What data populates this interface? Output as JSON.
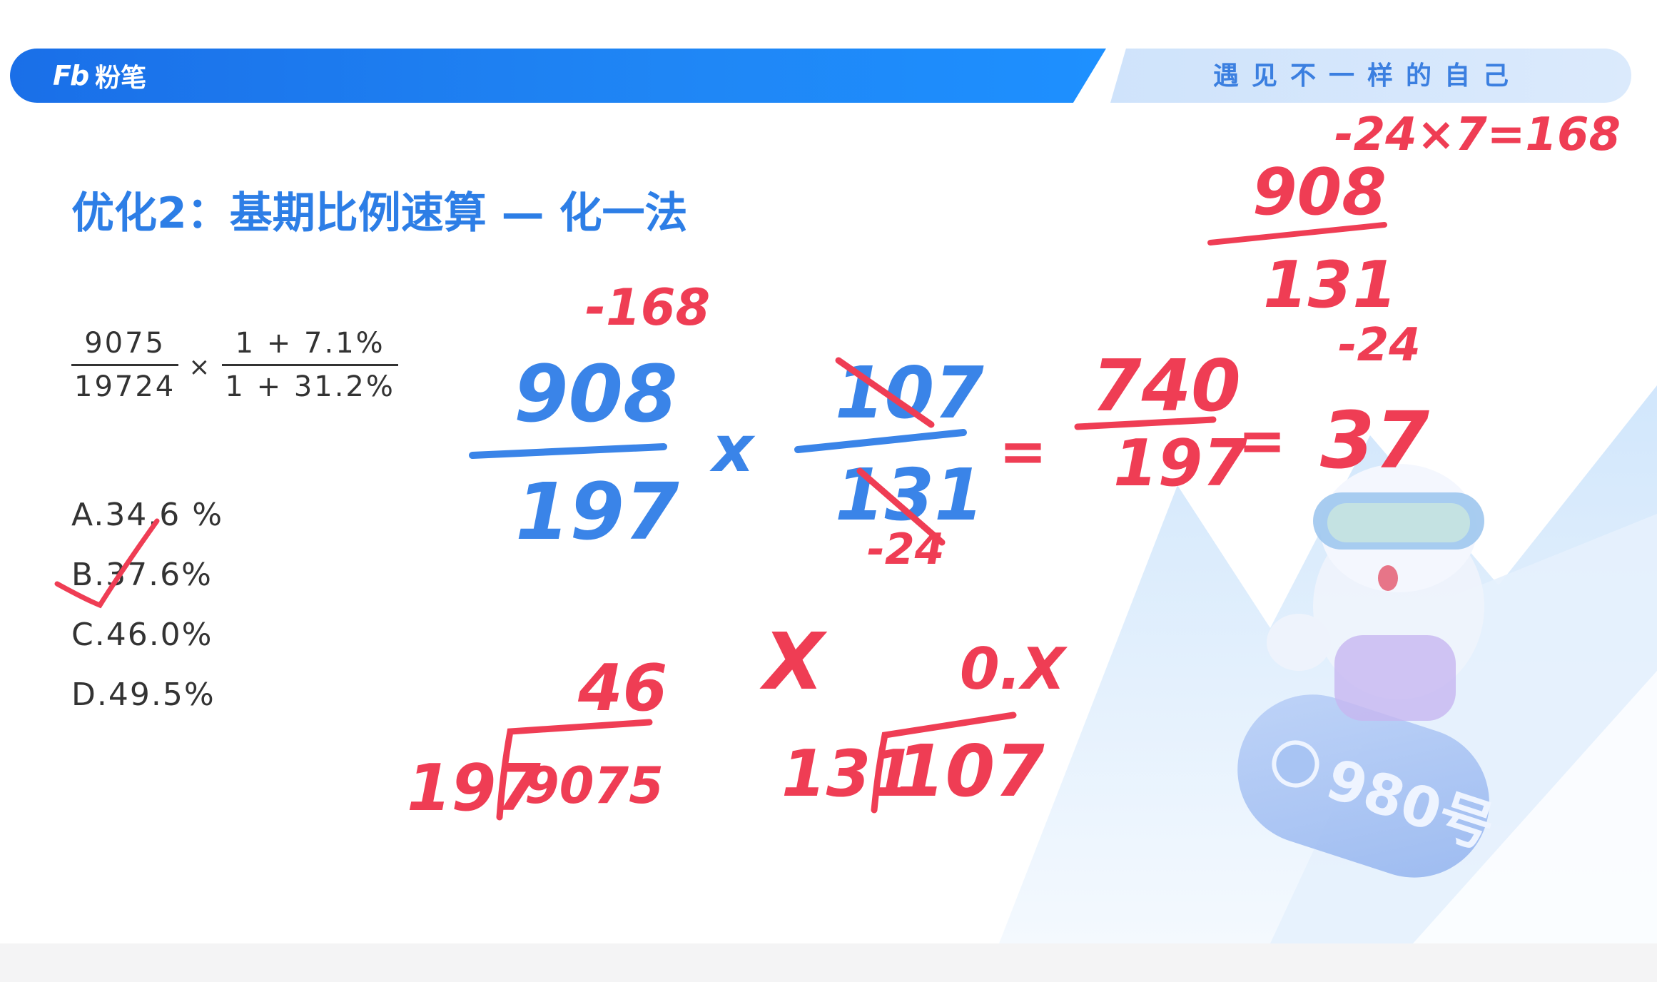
{
  "header": {
    "logo_mark": "Fb",
    "logo_text": "粉笔",
    "slogan": "遇见不一样的自己"
  },
  "slide": {
    "title": "优化2：基期比例速算 — 化一法"
  },
  "formula": {
    "frac1_num": "9075",
    "frac1_den": "19724",
    "times": "×",
    "frac2_num": "1 + 7.1%",
    "frac2_den": "1 + 31.2%"
  },
  "options": [
    {
      "label": "A.34.6 %"
    },
    {
      "label": "B.37.6%"
    },
    {
      "label": "C.46.0%"
    },
    {
      "label": "D.49.5%"
    }
  ],
  "handwriting": {
    "blue_frac1_num": "908",
    "blue_frac1_den": "197",
    "blue_times": "x",
    "blue_frac2_num": "107",
    "blue_frac2_den": "131",
    "red_minus168": "-168",
    "red_eq1": "=",
    "red_result_num": "740",
    "red_result_den": "197",
    "red_eq2": "=",
    "red_37": "37",
    "red_minus24_top": "-24",
    "red_minus24_side": "-24",
    "red_top_expr": "-24×7=168",
    "red_top_num": "908",
    "red_top_den": "131",
    "red_div1_quot": "46",
    "red_div1_divisor": "197",
    "red_div1_dividend": "9075",
    "red_x": "X",
    "red_div2_quot": "0.X",
    "red_div2_divisor": "131",
    "red_div2_dividend": "107"
  },
  "mascot": {
    "badge": "980号"
  },
  "colors": {
    "banner_blue": "#1f86f5",
    "title_blue": "#2d7ee6",
    "ink_blue": "#3a84e8",
    "ink_red": "#ef3d54"
  }
}
